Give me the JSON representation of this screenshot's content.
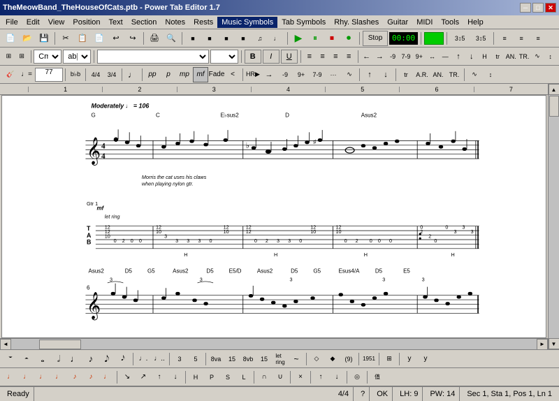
{
  "window": {
    "title": "TheMeowBand_TheHouseOfCats.ptb - Power Tab Editor 1.7",
    "min_btn": "─",
    "max_btn": "□",
    "close_btn": "✕"
  },
  "menu": {
    "items": [
      "File",
      "Edit",
      "View",
      "Position",
      "Text",
      "Section",
      "Notes",
      "Rests",
      "Music Symbols",
      "Tab Symbols",
      "Rhy. Slashes",
      "Guitar",
      "MIDI",
      "Tools",
      "Help"
    ]
  },
  "toolbar1": {
    "buttons": [
      "📄",
      "📂",
      "💾",
      "",
      "✂",
      "📋",
      "📄",
      "↩",
      "↪",
      "🖨",
      "🔍",
      "",
      "",
      "",
      "",
      "",
      "",
      "",
      "",
      "",
      ""
    ],
    "play_label": "▶",
    "pause_label": "⏸",
    "stop_label": "⏹",
    "record_label": "⏺",
    "time_display": "00:00"
  },
  "toolbar2": {
    "font_combo": "Cm",
    "style_combo": "ab|",
    "size_combo": "",
    "align_options": [
      "left",
      "center",
      "right",
      "justify"
    ],
    "bold": "B",
    "italic": "I",
    "underline": "U"
  },
  "toolbar3": {
    "tempo_label": "♩=",
    "tempo_value": "77",
    "time_sig": "4/4",
    "note_labels": [
      "b♭b",
      "4/4",
      "3/4",
      "♩",
      "𝅗𝅥",
      "mf",
      "Fade",
      "<"
    ]
  },
  "score": {
    "tempo_text": "Moderately ♩ = 106",
    "chords_line1": [
      "G",
      "C",
      "E♭sus2",
      "D",
      "Asus2"
    ],
    "chords_line2": [
      "Asus2",
      "D5",
      "G5",
      "Asus2",
      "D5",
      "E5/D",
      "Asus2",
      "D5",
      "G5",
      "Esus4/A",
      "D5",
      "E5"
    ],
    "annotation": "Morris the cat uses his claws\nwhen playing nylon gtr.",
    "guitar_label": "Gtr 1",
    "dynamics": "mf",
    "let_ring": "let ring"
  },
  "h_scroll": {
    "left_btn": "◄",
    "right_btn": "►"
  },
  "v_scroll": {
    "up_btn": "▲",
    "down_btn": "▼"
  },
  "bottom_toolbar1": {
    "symbols": [
      "𝅝",
      "♩",
      "♪",
      "♫",
      "𝅘𝅥𝅮",
      "♬",
      "𝆺𝅥",
      "𝆹𝅥",
      "𝅗",
      "𝅗𝅥",
      "𝅘𝅥",
      "𝅘𝅥𝅮",
      "𝅗𝅥",
      "𝅗𝅥",
      "♩",
      "♪",
      "♩",
      "8va",
      "15ma",
      "8vb",
      "15mb",
      "let\nring",
      "~",
      "",
      "",
      "",
      "(9)",
      "",
      "1951",
      "",
      "",
      "",
      "y",
      "y"
    ]
  },
  "bottom_toolbar2": {
    "symbols": [
      "♩",
      "♩",
      "♩",
      "♩",
      "♪",
      "♪",
      "♩",
      "𝅘𝅥",
      "𝅘𝅥",
      "𝅘𝅥",
      "𝅘𝅥",
      "𝆺𝅥",
      "𝆺𝅥",
      "𝆺𝅥",
      "𝆺𝅥",
      "",
      "",
      "",
      "",
      "",
      "",
      "",
      "",
      "",
      "",
      "",
      "",
      "",
      "",
      "",
      "",
      "",
      ""
    ]
  },
  "status_bar": {
    "ready": "Ready",
    "time_sig": "4/4",
    "question": "?",
    "ok": "OK",
    "lh": "LH: 9",
    "pw": "PW: 14",
    "position": "Sec 1, Sta 1, Pos 1, Ln 1"
  }
}
